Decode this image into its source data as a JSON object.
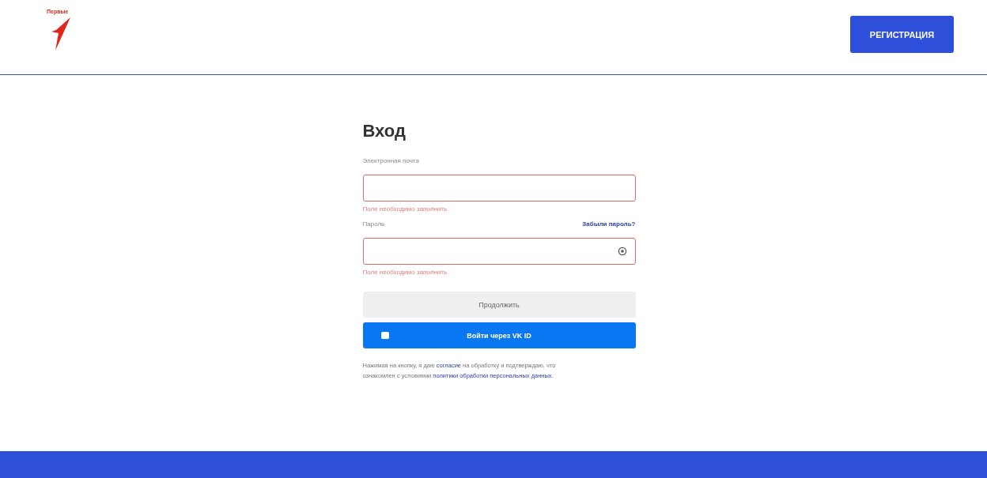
{
  "header": {
    "logo_text": "Первые",
    "register_button": "РЕГИСТРАЦИЯ"
  },
  "form": {
    "title": "Вход",
    "fields": [
      {
        "label": "Электронная почта",
        "kind": "email",
        "error": "Поле необходимо заполнить",
        "invalid": true
      },
      {
        "label": "Пароль",
        "kind": "password",
        "link": "Забыли пароль?",
        "error": "Поле необходимо заполнить",
        "invalid": true
      }
    ],
    "continue_button": {
      "label": "Продолжить",
      "disabled": true
    },
    "vk_button": "Войти через VK ID",
    "consent": [
      {
        "text": "Нажимая на кнопку, я даю ",
        "link": false
      },
      {
        "text": "согласие",
        "link": true
      },
      {
        "text": " на обработку и подтверждаю, что ознакомлен с условиями ",
        "link": false
      },
      {
        "text": "политики обработки персональных данных.",
        "link": true
      }
    ]
  }
}
